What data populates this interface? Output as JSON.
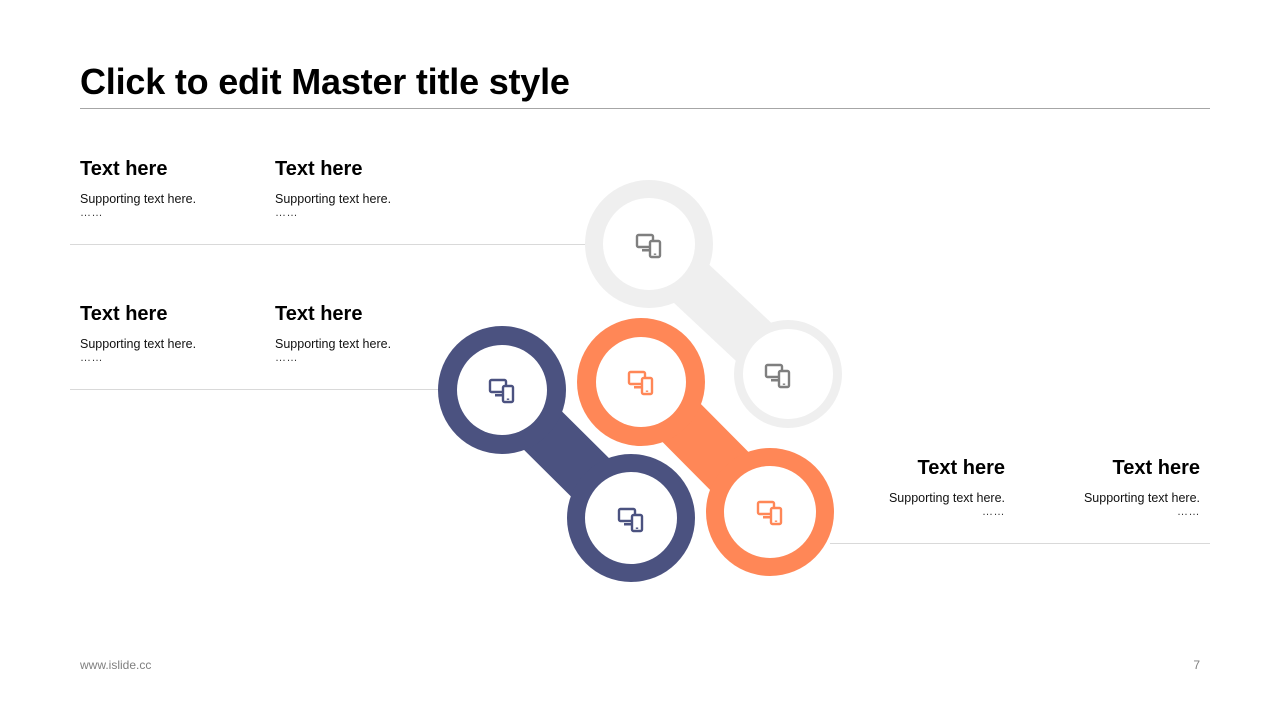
{
  "slide": {
    "title": "Click to edit Master title style",
    "footer_url": "www.islide.cc",
    "page_number": "7"
  },
  "colors": {
    "gray": "#efefef",
    "navy": "#4b5280",
    "orange": "#ff8757",
    "gray_icon": "#7f7f7f"
  },
  "icons": {
    "device": "devices-icon"
  },
  "blocks": [
    {
      "heading": "Text here",
      "support": "Supporting text here.",
      "dots": "……"
    },
    {
      "heading": "Text here",
      "support": "Supporting text here.",
      "dots": "……"
    },
    {
      "heading": "Text here",
      "support": "Supporting text here.",
      "dots": "……"
    },
    {
      "heading": "Text here",
      "support": "Supporting text here.",
      "dots": "……"
    },
    {
      "heading": "Text here",
      "support": "Supporting text here.",
      "dots": "……"
    },
    {
      "heading": "Text here",
      "support": "Supporting text here.",
      "dots": "……"
    }
  ]
}
